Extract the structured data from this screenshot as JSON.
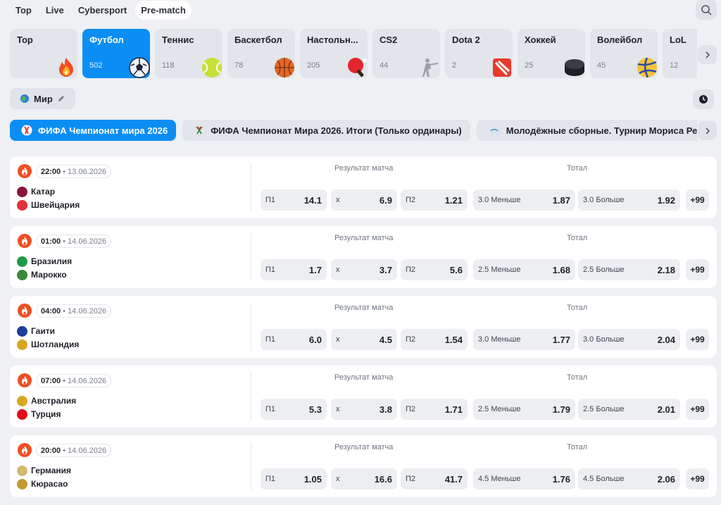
{
  "topbar": {
    "tabs": [
      "Top",
      "Live",
      "Cybersport",
      "Pre-match"
    ],
    "active_tab": 3
  },
  "sports": [
    {
      "name": "Top",
      "count": "",
      "icon": "fire-icon"
    },
    {
      "name": "Футбол",
      "count": "502",
      "icon": "soccer-ball-icon"
    },
    {
      "name": "Теннис",
      "count": "118",
      "icon": "tennis-ball-icon"
    },
    {
      "name": "Баскетбол",
      "count": "78",
      "icon": "basketball-icon"
    },
    {
      "name": "Настольн...",
      "count": "205",
      "icon": "ping-pong-paddle-icon"
    },
    {
      "name": "CS2",
      "count": "44",
      "icon": "soldier-icon"
    },
    {
      "name": "Dota 2",
      "count": "2",
      "icon": "dota-icon"
    },
    {
      "name": "Хоккей",
      "count": "25",
      "icon": "hockey-puck-icon"
    },
    {
      "name": "Волейбол",
      "count": "45",
      "icon": "volleyball-icon"
    },
    {
      "name": "LoL",
      "count": "12",
      "icon": "lol-icon"
    }
  ],
  "region": {
    "label": "Мир"
  },
  "championships": [
    {
      "label": "ФИФА Чемпионат мира 2026",
      "active": true
    },
    {
      "label": "ФИФА Чемпионат Мира 2026. Итоги (Только ординары)",
      "active": false
    },
    {
      "label": "Молодёжные сборные. Турнир Мориса Реве",
      "active": false
    }
  ],
  "labels": {
    "result": "Результат матча",
    "total": "Тотал",
    "p1": "П1",
    "x": "х",
    "p2": "П2"
  },
  "matches": [
    {
      "time": "22:00",
      "date": "• 13.06.2026",
      "team1": "Катар",
      "team2": "Швейцария",
      "p1": "14.1",
      "x": "6.9",
      "p2": "1.21",
      "under_label": "3.0 Меньше",
      "under": "1.87",
      "over_label": "3.0 Больше",
      "over": "1.92",
      "more": "+99",
      "flag1": "#8a1538",
      "flag2": "#e0303a"
    },
    {
      "time": "01:00",
      "date": "• 14.06.2026",
      "team1": "Бразилия",
      "team2": "Марокко",
      "p1": "1.7",
      "x": "3.7",
      "p2": "5.6",
      "under_label": "2.5 Меньше",
      "under": "1.68",
      "over_label": "2.5 Больше",
      "over": "2.18",
      "more": "+99",
      "flag1": "#1f9a4a",
      "flag2": "#3a8a3a"
    },
    {
      "time": "04:00",
      "date": "• 14.06.2026",
      "team1": "Гаити",
      "team2": "Шотландия",
      "p1": "6.0",
      "x": "4.5",
      "p2": "1.54",
      "under_label": "3.0 Меньше",
      "under": "1.77",
      "over_label": "3.0 Больше",
      "over": "2.04",
      "more": "+99",
      "flag1": "#1b3f9a",
      "flag2": "#d9a520"
    },
    {
      "time": "07:00",
      "date": "• 14.06.2026",
      "team1": "Австралия",
      "team2": "Турция",
      "p1": "5.3",
      "x": "3.8",
      "p2": "1.71",
      "under_label": "2.5 Меньше",
      "under": "1.79",
      "over_label": "2.5 Больше",
      "over": "2.01",
      "more": "+99",
      "flag1": "#d8a820",
      "flag2": "#e30a17"
    },
    {
      "time": "20:00",
      "date": "• 14.06.2026",
      "team1": "Германия",
      "team2": "Кюрасао",
      "p1": "1.05",
      "x": "16.6",
      "p2": "41.7",
      "under_label": "4.5 Меньше",
      "under": "1.76",
      "over_label": "4.5 Больше",
      "over": "2.06",
      "more": "+99",
      "flag1": "#d4b870",
      "flag2": "#c29a30"
    }
  ],
  "colors": {
    "accent": "#0b8ef4",
    "fire": "#f04e23"
  }
}
